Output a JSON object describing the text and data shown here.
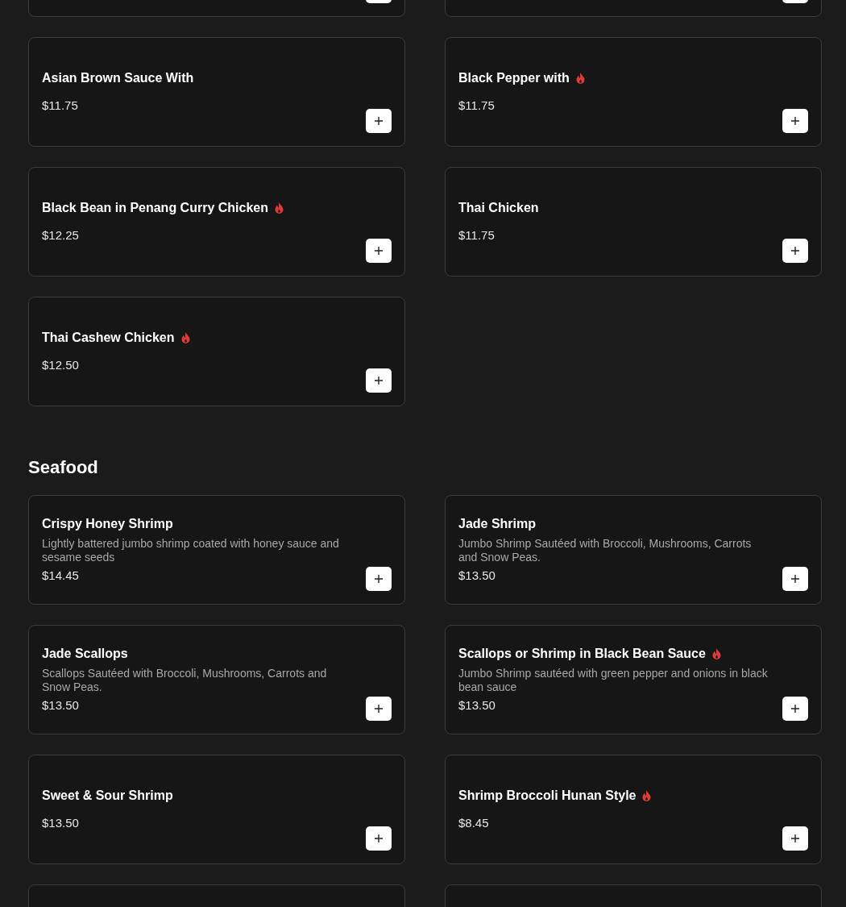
{
  "sections": [
    {
      "items": [
        {
          "kind": "cut"
        },
        {
          "kind": "cut"
        },
        {
          "kind": "dish",
          "name": "Asian Brown Sauce With",
          "spicy": false,
          "price": "$11.75"
        },
        {
          "kind": "dish",
          "name": "Black Pepper with",
          "spicy": true,
          "price": "$11.75"
        },
        {
          "kind": "dish",
          "name": "Black Bean in Penang Curry Chicken",
          "spicy": true,
          "price": "$12.25"
        },
        {
          "kind": "dish",
          "name": "Thai Chicken",
          "spicy": false,
          "price": "$11.75"
        },
        {
          "kind": "dish",
          "name": "Thai Cashew Chicken",
          "spicy": true,
          "price": "$12.50"
        }
      ]
    },
    {
      "title": "Seafood",
      "items": [
        {
          "kind": "dish",
          "name": "Crispy Honey Shrimp",
          "spicy": false,
          "description": "Lightly battered jumbo shrimp coated with honey sauce and sesame seeds",
          "price": "$14.45"
        },
        {
          "kind": "dish",
          "name": "Jade Shrimp",
          "spicy": false,
          "description": "Jumbo Shrimp Sautéed with Broccoli, Mushrooms, Carrots and Snow Peas.",
          "price": "$13.50"
        },
        {
          "kind": "dish",
          "name": "Jade Scallops",
          "spicy": false,
          "description": "Scallops Sautéed with Broccoli, Mushrooms, Carrots and Snow Peas.",
          "price": "$13.50"
        },
        {
          "kind": "dish",
          "name": "Scallops or Shrimp in Black Bean Sauce",
          "spicy": true,
          "description": "Jumbo Shrimp sautéed with green pepper and onions in black bean sauce",
          "price": "$13.50"
        },
        {
          "kind": "dish",
          "name": "Sweet & Sour Shrimp",
          "spicy": false,
          "price": "$13.50"
        },
        {
          "kind": "dish",
          "name": "Shrimp Broccoli Hunan Style",
          "spicy": true,
          "price": "$8.45"
        },
        {
          "kind": "edge"
        },
        {
          "kind": "edge"
        }
      ]
    }
  ]
}
